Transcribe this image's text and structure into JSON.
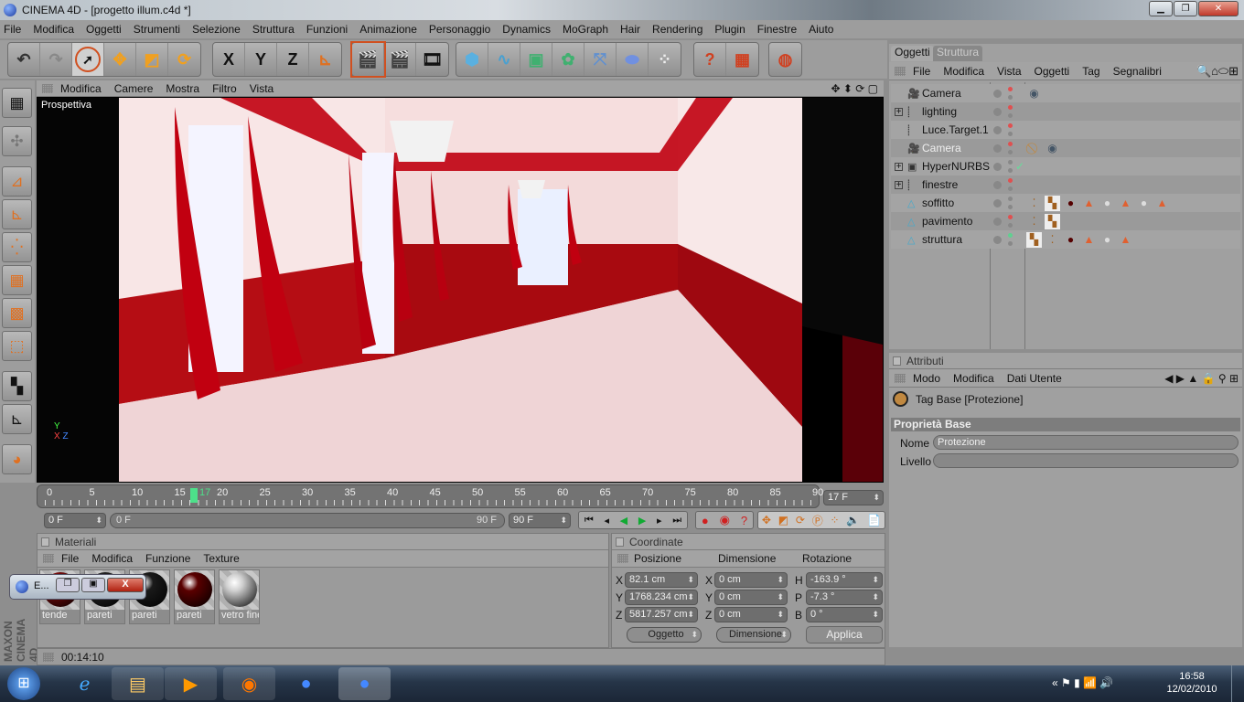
{
  "window": {
    "title": "CINEMA 4D - [progetto illum.c4d *]"
  },
  "menu": [
    "File",
    "Modifica",
    "Oggetti",
    "Strumenti",
    "Selezione",
    "Struttura",
    "Funzioni",
    "Animazione",
    "Personaggio",
    "Dynamics",
    "MoGraph",
    "Hair",
    "Rendering",
    "Plugin",
    "Finestre",
    "Aiuto"
  ],
  "axes": {
    "x": "X",
    "y": "Y",
    "z": "Z"
  },
  "viewport": {
    "menu": [
      "Modifica",
      "Camere",
      "Mostra",
      "Filtro",
      "Vista"
    ],
    "label": "Prospettiva"
  },
  "timeline": {
    "ticks": [
      "0",
      "5",
      "10",
      "15",
      "20",
      "25",
      "30",
      "35",
      "40",
      "45",
      "50",
      "55",
      "60",
      "65",
      "70",
      "75",
      "80",
      "85",
      "90"
    ],
    "current": "17",
    "current_field": "17 F",
    "start": "0 F",
    "range_start": "0 F",
    "range_end": "90 F",
    "end": "90 F"
  },
  "materials": {
    "title": "Materiali",
    "menu": [
      "File",
      "Modifica",
      "Funzione",
      "Texture"
    ],
    "items": [
      {
        "name": "tende",
        "color": "#7a0a0a"
      },
      {
        "name": "pareti",
        "color": "#222"
      },
      {
        "name": "pareti",
        "color": "#1a1a1a"
      },
      {
        "name": "pareti",
        "color": "#5a0000"
      },
      {
        "name": "vetro fine",
        "color": "#d0d0d0"
      }
    ]
  },
  "coordinates": {
    "title": "Coordinate",
    "headers": [
      "Posizione",
      "Dimensione",
      "Rotazione"
    ],
    "rows": [
      {
        "pl": "X",
        "p": "82.1 cm",
        "dl": "X",
        "d": "0 cm",
        "rl": "H",
        "r": "-163.9 °"
      },
      {
        "pl": "Y",
        "p": "1768.234 cm",
        "dl": "Y",
        "d": "0 cm",
        "rl": "P",
        "r": "-7.3 °"
      },
      {
        "pl": "Z",
        "p": "5817.257 cm",
        "dl": "Z",
        "d": "0 cm",
        "rl": "B",
        "r": "0 °"
      }
    ],
    "mode": "Oggetto",
    "size_mode": "Dimensione",
    "apply": "Applica"
  },
  "status": {
    "text": "00:14:10"
  },
  "popup": {
    "label": "E..."
  },
  "brand": "MAXON CINEMA 4D",
  "objects": {
    "tabs": [
      "Oggetti",
      "Struttura"
    ],
    "menu": [
      "File",
      "Modifica",
      "Vista",
      "Oggetti",
      "Tag",
      "Segnalibri"
    ],
    "items": [
      {
        "name": "Camera",
        "icon": "camera",
        "expand": false,
        "d1": "#e05050",
        "tags": [
          "camera-target"
        ]
      },
      {
        "name": "lighting",
        "icon": "null",
        "expand": true,
        "d1": "#e05050",
        "tags": []
      },
      {
        "name": "Luce.Target.1",
        "icon": "null",
        "expand": false,
        "d1": "#e05050",
        "tags": []
      },
      {
        "name": "Camera",
        "icon": "camera",
        "expand": false,
        "d1": "#e05050",
        "selected": true,
        "tags": [
          "protection",
          "camera-target"
        ]
      },
      {
        "name": "HyperNURBS",
        "icon": "hypernurbs",
        "expand": true,
        "d1": "#888",
        "check": true,
        "tags": []
      },
      {
        "name": "finestre",
        "icon": "null",
        "expand": true,
        "d1": "#e05050",
        "tags": []
      },
      {
        "name": "soffitto",
        "icon": "polygon",
        "expand": false,
        "d1": "#888",
        "tags": [
          "uvw",
          "texture",
          "material-red",
          "triangle",
          "material-white",
          "triangle",
          "material-white",
          "triangle"
        ]
      },
      {
        "name": "pavimento",
        "icon": "polygon",
        "expand": false,
        "d1": "#e05050",
        "tags": [
          "uvw",
          "texture"
        ]
      },
      {
        "name": "struttura",
        "icon": "polygon",
        "expand": false,
        "d1": "#60d090",
        "tags": [
          "texture",
          "uvw",
          "material-red",
          "triangle",
          "material-white",
          "triangle"
        ]
      }
    ]
  },
  "attributes": {
    "title": "Attributi",
    "menu": [
      "Modo",
      "Modifica",
      "Dati Utente"
    ],
    "object": "Tag Base [Protezione]",
    "section": "Proprietà Base",
    "fields": [
      {
        "label": "Nome",
        "value": "Protezione"
      },
      {
        "label": "Livello",
        "value": ""
      }
    ]
  },
  "taskbar": {
    "time": "16:58",
    "date": "12/02/2010"
  }
}
